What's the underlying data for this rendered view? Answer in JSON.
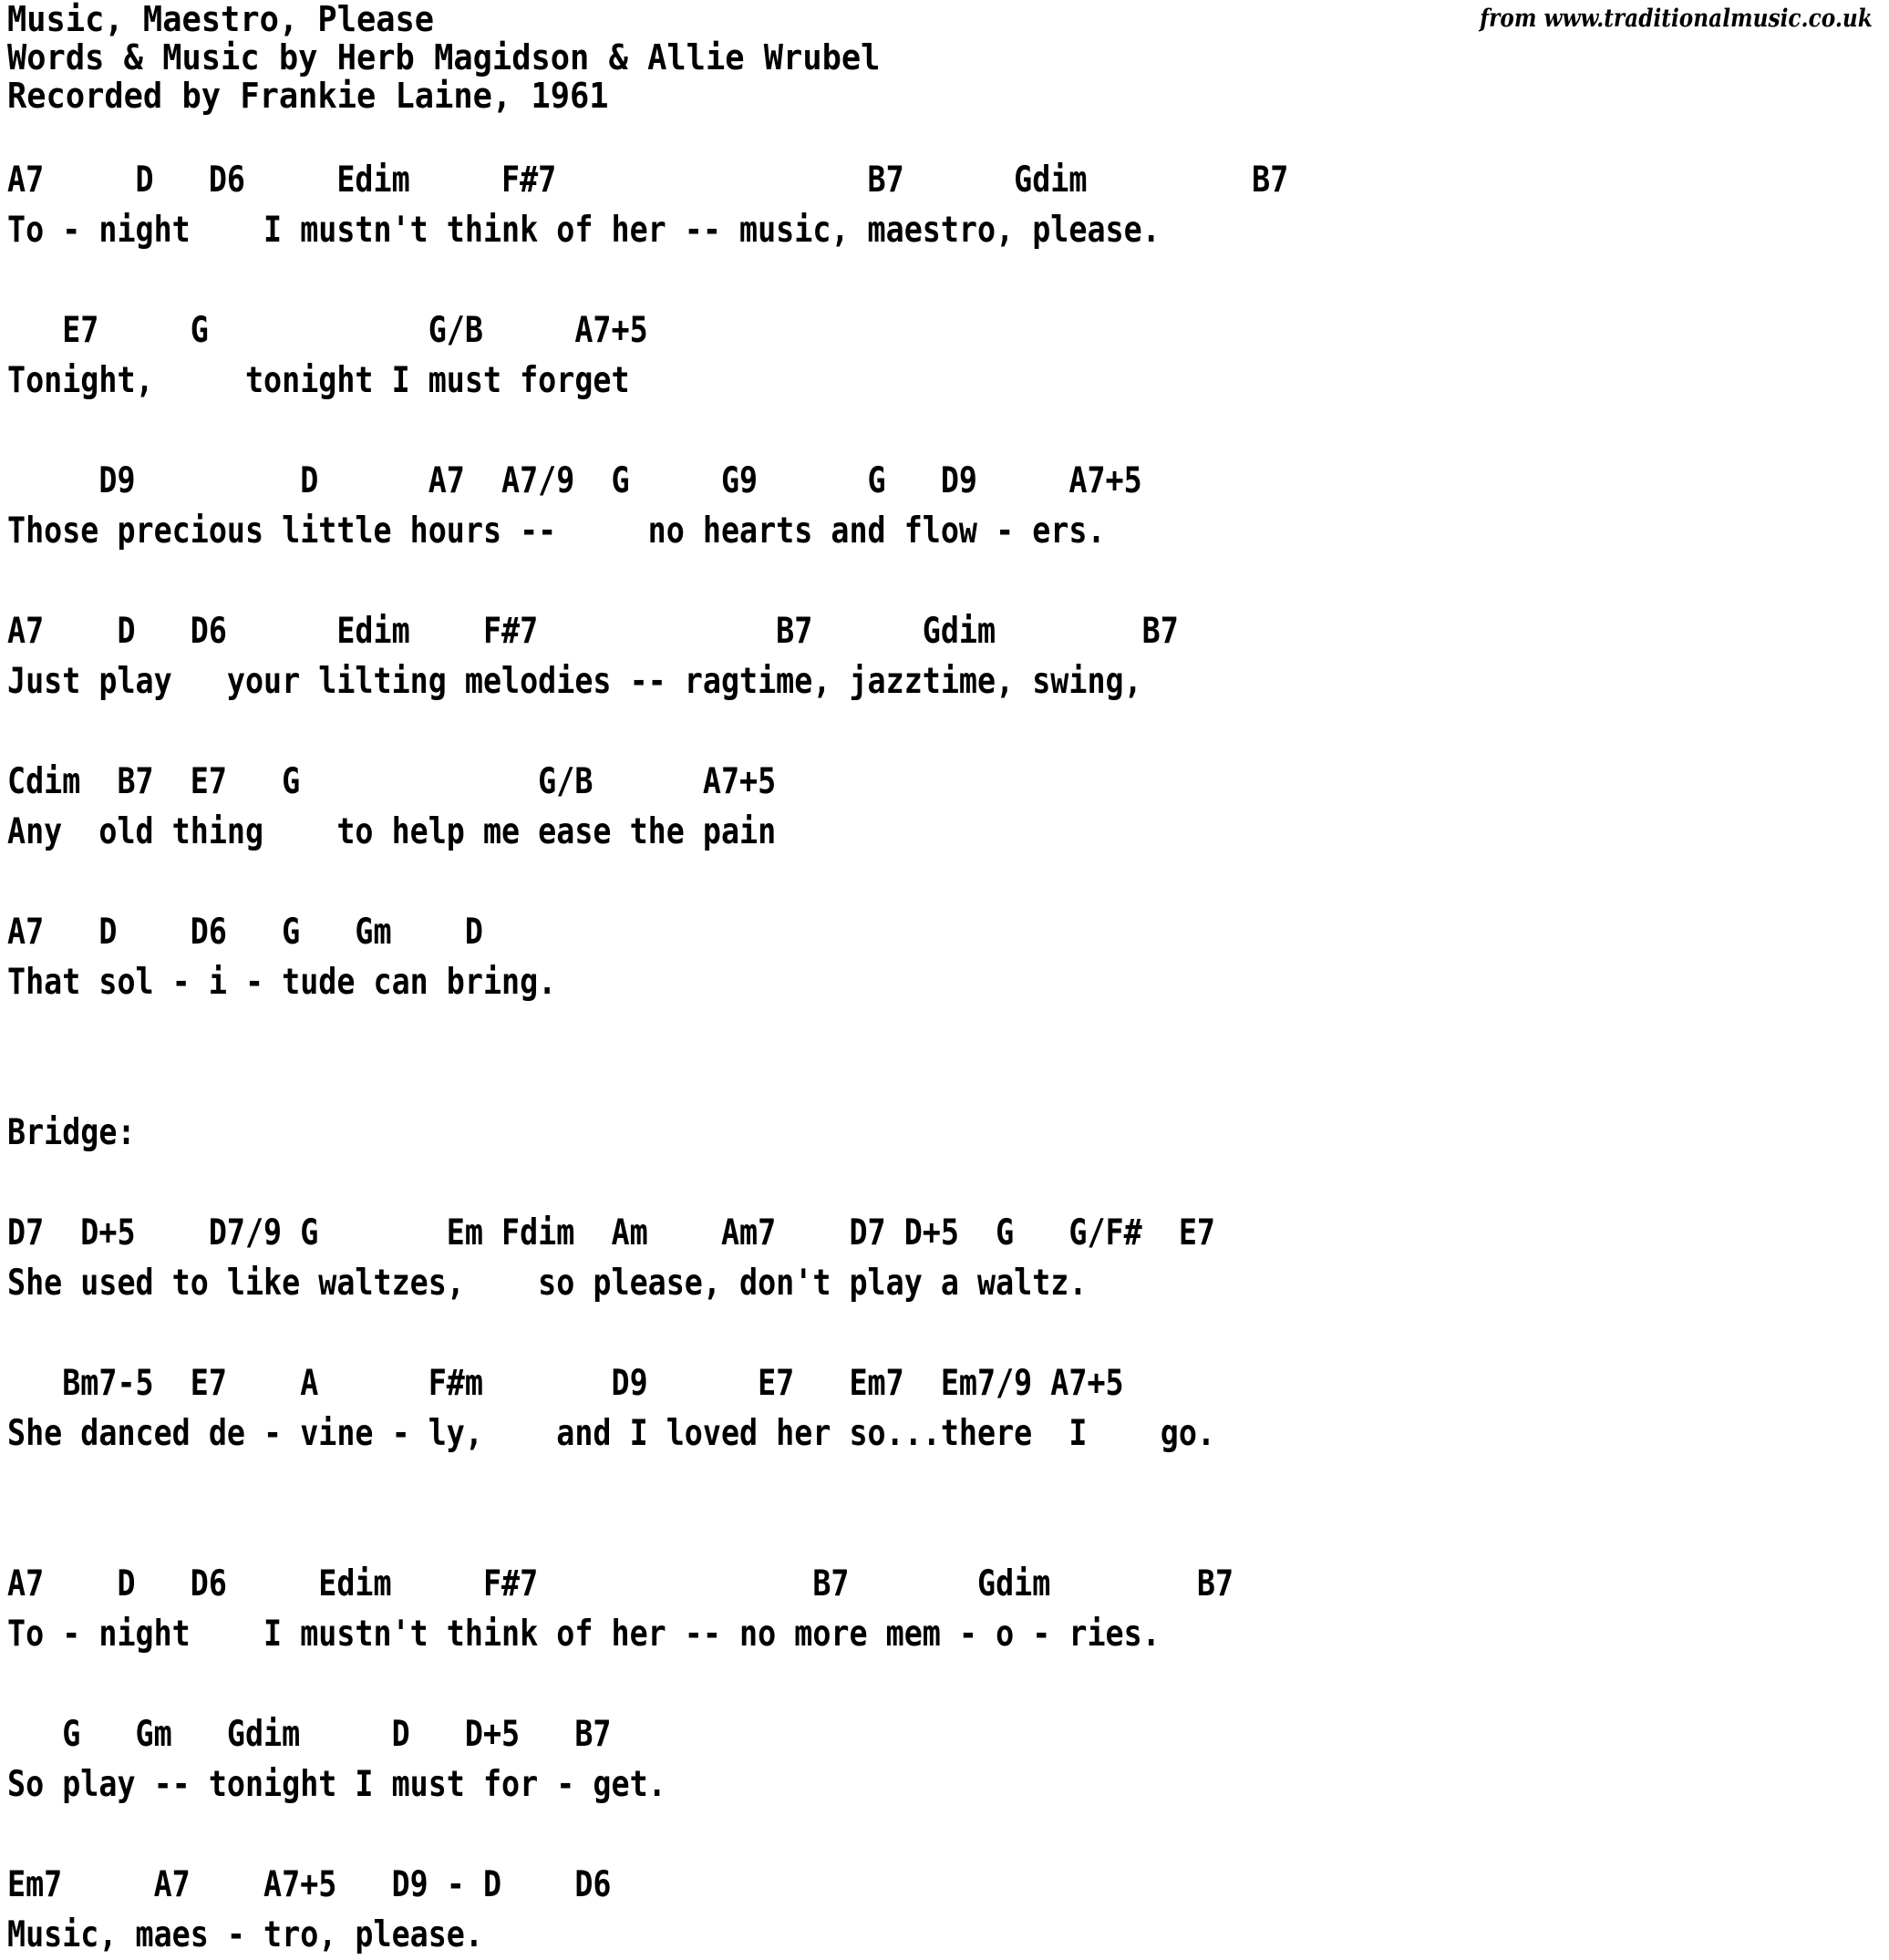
{
  "header": {
    "title": "Music, Maestro, Please",
    "credits": "Words & Music by Herb Magidson & Allie Wrubel",
    "recording": "Recorded by Frankie Laine, 1961",
    "attribution": "from www.traditionalmusic.co.uk"
  },
  "song": {
    "bridge_label": "Bridge:",
    "blocks": [
      {
        "id": "verse-1",
        "chords": "A7     D   D6     Edim     F#7                 B7      Gdim         B7",
        "lyrics": "To - night    I mustn't think of her -- music, maestro, please."
      },
      {
        "id": "verse-2",
        "chords": "   E7     G            G/B     A7+5",
        "lyrics": "Tonight,     tonight I must forget"
      },
      {
        "id": "verse-3",
        "chords": "     D9         D      A7  A7/9  G     G9      G   D9     A7+5",
        "lyrics": "Those precious little hours --     no hearts and flow - ers."
      },
      {
        "id": "verse-4",
        "chords": "A7    D   D6      Edim    F#7             B7      Gdim        B7",
        "lyrics": "Just play   your lilting melodies -- ragtime, jazztime, swing,"
      },
      {
        "id": "verse-5",
        "chords": "Cdim  B7  E7   G             G/B      A7+5",
        "lyrics": "Any  old thing    to help me ease the pain"
      },
      {
        "id": "verse-6",
        "chords": "A7   D    D6   G   Gm    D",
        "lyrics": "That sol - i - tude can bring."
      },
      {
        "id": "bridge-line-1",
        "chords": "D7  D+5    D7/9 G       Em Fdim  Am    Am7    D7 D+5  G   G/F#  E7",
        "lyrics": "She used to like waltzes,    so please, don't play a waltz."
      },
      {
        "id": "bridge-line-2",
        "chords": "   Bm7-5  E7    A      F#m       D9      E7   Em7  Em7/9 A7+5",
        "lyrics": "She danced de - vine - ly,    and I loved her so...there  I    go."
      },
      {
        "id": "verse-7",
        "chords": "A7    D   D6     Edim     F#7               B7       Gdim        B7",
        "lyrics": "To - night    I mustn't think of her -- no more mem - o - ries."
      },
      {
        "id": "verse-8",
        "chords": "   G   Gm   Gdim     D   D+5   B7",
        "lyrics": "So play -- tonight I must for - get."
      },
      {
        "id": "verse-9",
        "chords": "Em7     A7    A7+5   D9 - D    D6",
        "lyrics": "Music, maes - tro, please."
      }
    ]
  }
}
